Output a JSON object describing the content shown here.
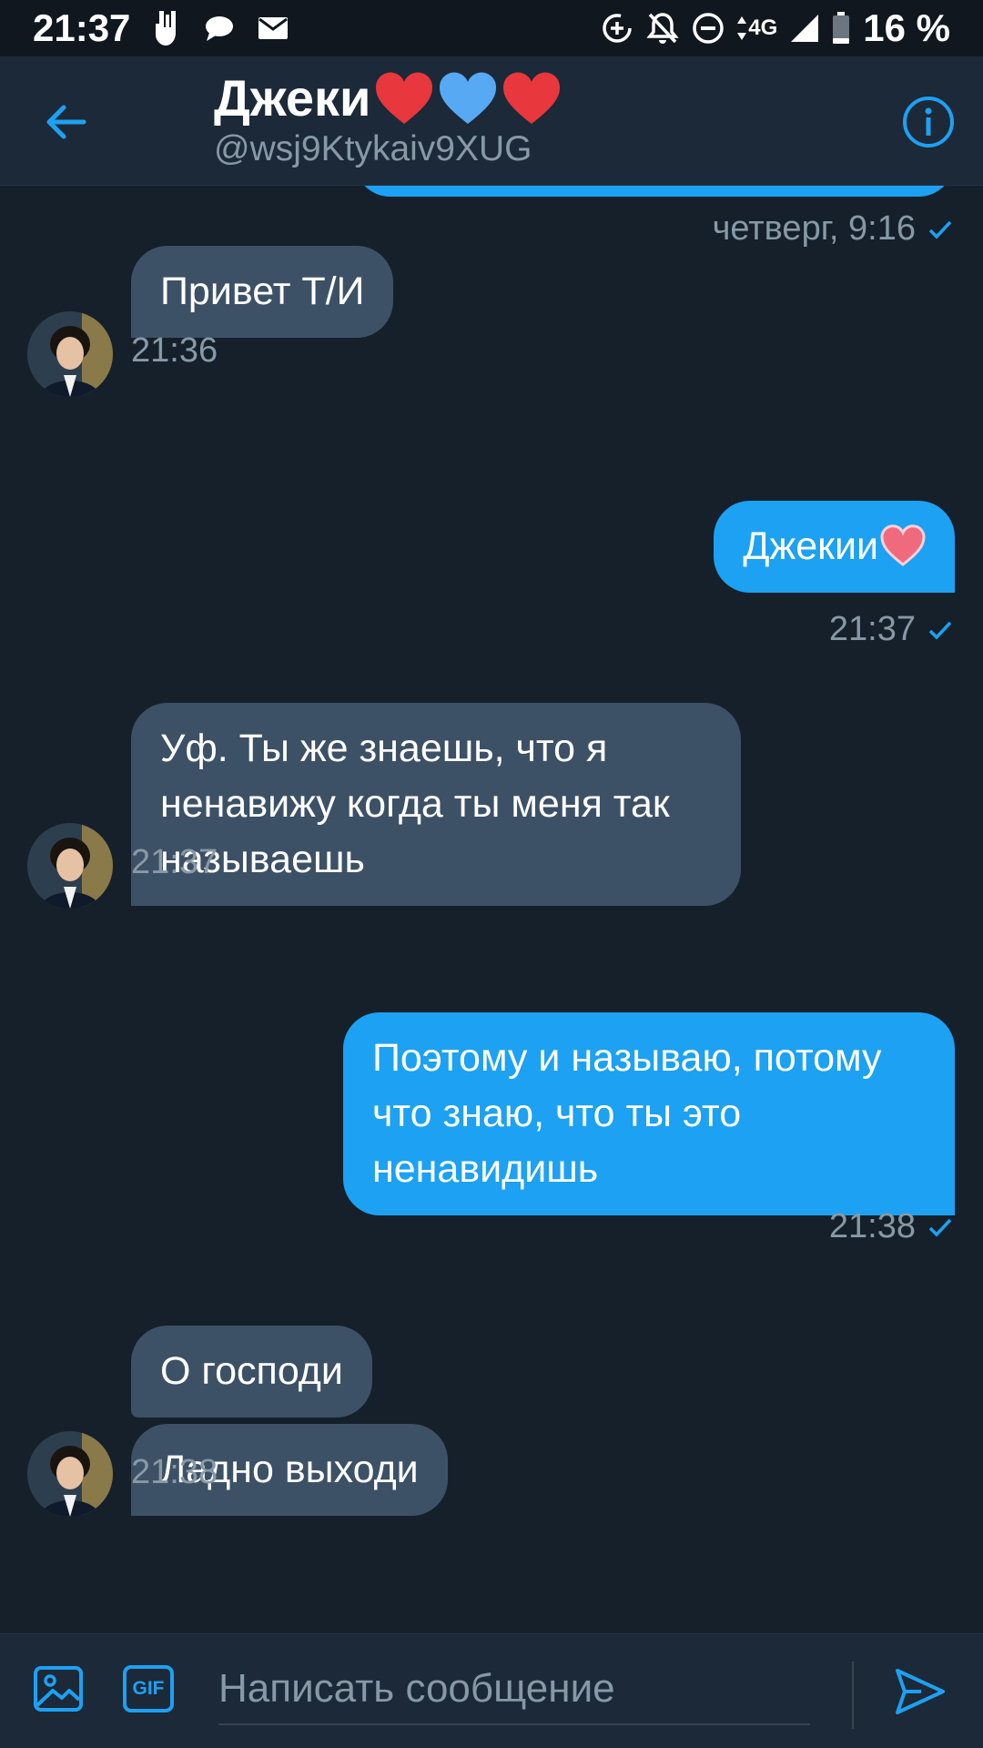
{
  "status_bar": {
    "time": "21:37",
    "network": "4G",
    "battery": "16 %"
  },
  "header": {
    "contact_name": "Джеки",
    "contact_handle": "@wsj9Ktykaiv9XUG",
    "accent_color": "#1da1f2",
    "heart_colors": [
      "#e8373d",
      "#58a9f3",
      "#e8373d"
    ]
  },
  "conversation": {
    "previous_timestamp": "четверг, 9:16",
    "messages": [
      {
        "direction": "in",
        "text": "Привет Т/И",
        "time": "21:36"
      },
      {
        "direction": "out",
        "text": "Джекии",
        "time": "21:37"
      },
      {
        "direction": "in",
        "text": "Уф. Ты же знаешь, что я ненавижу когда ты меня так называешь",
        "time": "21:37"
      },
      {
        "direction": "out",
        "text": "Поэтому и называю, потому что знаю, что ты это ненавидишь",
        "time": "21:38"
      },
      {
        "direction": "in",
        "text": "О господи",
        "time": ""
      },
      {
        "direction": "in",
        "text": "Ладно выходи",
        "time": "21:38"
      }
    ]
  },
  "composer": {
    "placeholder": "Написать сообщение",
    "gif_label": "GIF"
  }
}
